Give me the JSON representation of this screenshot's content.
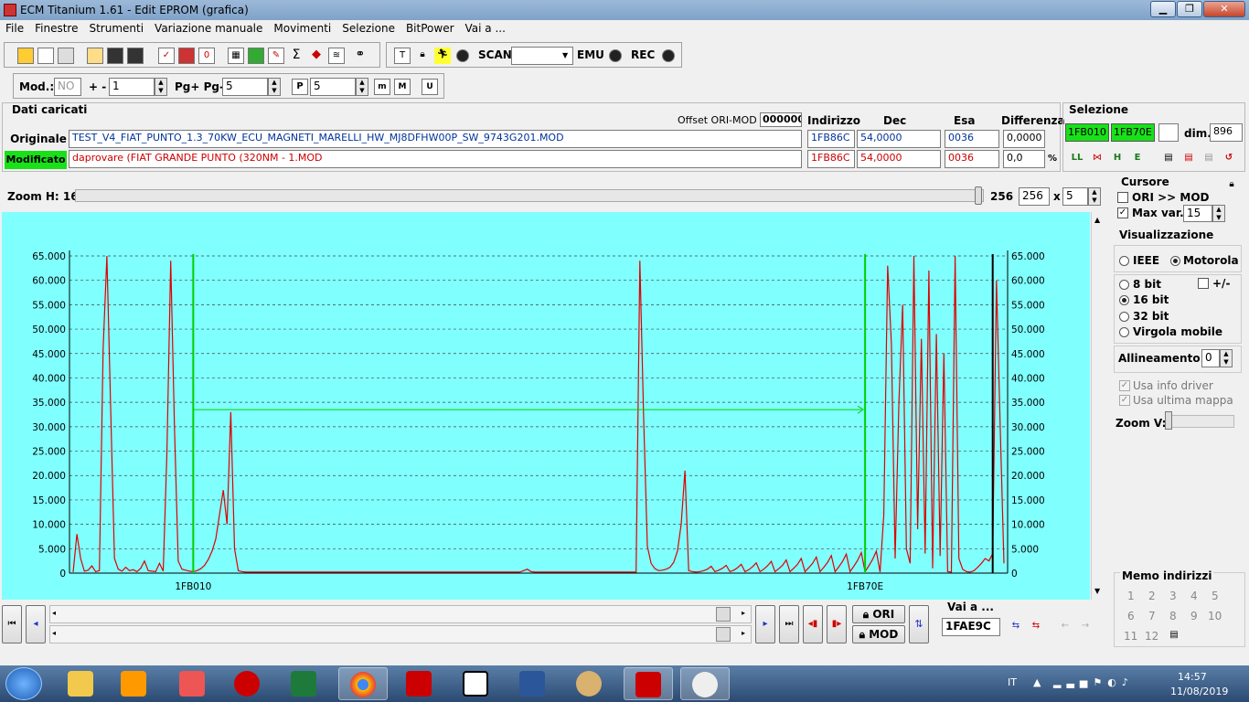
{
  "window": {
    "title": "ECM Titanium 1.61 - Edit EPROM (grafica)"
  },
  "menu": [
    "File",
    "Finestre",
    "Strumenti",
    "Variazione manuale",
    "Movimenti",
    "Selezione",
    "BitPower",
    "Vai a ..."
  ],
  "toolbar": {
    "scan_label": "SCAN",
    "emu_label": "EMU",
    "rec_label": "REC",
    "scan_value": ""
  },
  "modbar": {
    "mod_label": "Mod.:",
    "mod_value": "NO",
    "plusminus_label": "+ -",
    "plusminus_value": "1",
    "pg_label": "Pg+ Pg-",
    "pg_value": "5",
    "p_value": "5"
  },
  "dati": {
    "section_title": "Dati caricati",
    "offset_label": "Offset ORI-MOD",
    "offset_value": "000000",
    "col_indirizzo": "Indirizzo",
    "col_dec": "Dec",
    "col_esa": "Esa",
    "col_diff": "Differenza",
    "originale_label": "Originale",
    "originale_file": "TEST_V4_FIAT_PUNTO_1.3_70KW_ECU_MAGNETI_MARELLI_HW_MJ8DFHW00P_SW_9743G201.MOD",
    "originale_addr": "1FB86C",
    "originale_dec": "54,0000",
    "originale_esa": "0036",
    "originale_diff": "0,0000",
    "modificato_label": "Modificato",
    "modificato_file": "daprovare (FIAT GRANDE PUNTO (320NM - 1.MOD",
    "modificato_addr": "1FB86C",
    "modificato_dec": "54,0000",
    "modificato_esa": "0036",
    "modificato_diff": "0,0",
    "percent": "%"
  },
  "selezione": {
    "title": "Selezione",
    "start": "1FB010",
    "end": "1FB70E",
    "dim_label": "dim.",
    "dim_value": "896"
  },
  "zoom": {
    "label": "Zoom H: 16",
    "value_a": "256",
    "value_b": "256",
    "x_label": "x",
    "mult": "5"
  },
  "cursore": {
    "title": "Cursore",
    "ori_mod": "ORI >> MOD",
    "max_var": "Max var.",
    "max_var_value": "15"
  },
  "visualizzazione": {
    "title": "Visualizzazione",
    "ieee": "IEEE",
    "motorola": "Motorola",
    "bit8": "8 bit",
    "bit16": "16 bit",
    "bit32": "32 bit",
    "virgola": "Virgola mobile",
    "plusminus": "+/-",
    "allineamento_label": "Allineamento:",
    "allineamento_value": "0",
    "usa_info": "Usa info driver",
    "usa_mappa": "Usa ultima mappa",
    "zoom_v": "Zoom V:"
  },
  "memo": {
    "title": "Memo indirizzi",
    "items": [
      "1",
      "2",
      "3",
      "4",
      "5",
      "6",
      "7",
      "8",
      "9",
      "10",
      "11",
      "12"
    ]
  },
  "bottom": {
    "ori_label": "ORI",
    "mod_label": "MOD",
    "vai_label": "Vai a ...",
    "vai_value": "1FAE9C"
  },
  "chart_data": {
    "type": "line",
    "ylim": [
      0,
      65000
    ],
    "y_ticks": [
      "0",
      "5.000",
      "10.000",
      "15.000",
      "20.000",
      "25.000",
      "30.000",
      "35.000",
      "40.000",
      "45.000",
      "50.000",
      "55.000",
      "60.000",
      "65.000"
    ],
    "x_ticks": [
      "1FB010",
      "1FB70E"
    ],
    "grid": "horizontal dashed",
    "colors": {
      "series": "#e00000",
      "marker_start": "#00d000",
      "marker_end": "#00d000",
      "cursor": "#000000",
      "background": "#80ffff"
    },
    "series": [
      {
        "values": [
          200,
          8000,
          3000,
          400,
          600,
          1500,
          300,
          500,
          46000,
          65000,
          34000,
          3000,
          800,
          400,
          1200,
          500,
          700,
          300,
          1000,
          2500,
          500,
          400,
          300,
          2000,
          400,
          25000,
          64000,
          30000,
          2500,
          800,
          600,
          400,
          300,
          500,
          900,
          1600,
          2800,
          4500,
          7000,
          12000,
          17000,
          10000,
          33000,
          5000,
          500,
          300,
          200,
          200,
          200,
          200,
          200,
          200,
          200,
          200,
          200,
          200,
          200,
          200,
          200,
          200,
          200,
          200,
          200,
          200,
          200,
          200,
          200,
          200,
          200,
          200,
          200,
          200,
          200,
          200,
          200,
          200,
          200,
          200,
          200,
          200,
          200,
          200,
          200,
          200,
          200,
          200,
          200,
          200,
          200,
          200,
          200,
          200,
          200,
          200,
          200,
          200,
          200,
          200,
          200,
          200,
          200,
          200,
          200,
          200,
          200,
          200,
          200,
          200,
          200,
          200,
          200,
          200,
          200,
          200,
          200,
          200,
          200,
          200,
          200,
          200,
          500,
          800,
          300,
          200,
          200,
          200,
          200,
          200,
          200,
          200,
          200,
          200,
          200,
          200,
          200,
          200,
          200,
          200,
          200,
          200,
          200,
          200,
          200,
          200,
          200,
          200,
          200,
          200,
          200,
          200,
          200,
          64000,
          32000,
          5500,
          2000,
          900,
          500,
          600,
          800,
          1200,
          2200,
          4500,
          10000,
          21000,
          500,
          300,
          200,
          300,
          500,
          800,
          1400,
          300,
          600,
          1000,
          1600,
          300,
          600,
          1100,
          1800,
          300,
          700,
          1300,
          2100,
          300,
          800,
          1500,
          2400,
          300,
          900,
          1600,
          2700,
          300,
          1000,
          1800,
          3000,
          300,
          1100,
          2000,
          3300,
          300,
          1200,
          2200,
          3600,
          300,
          1300,
          2400,
          3900,
          300,
          1400,
          2600,
          4200,
          300,
          1500,
          2800,
          4500,
          200,
          12000,
          63000,
          47000,
          3000,
          35000,
          55000,
          5000,
          2000,
          65000,
          9000,
          48000,
          4000,
          62000,
          1000,
          49000,
          3500,
          45000,
          300,
          200,
          65000,
          3000,
          800,
          300,
          200,
          500,
          1200,
          2000,
          3000,
          2500,
          4000,
          60000,
          30000,
          2000
        ]
      }
    ]
  }
}
